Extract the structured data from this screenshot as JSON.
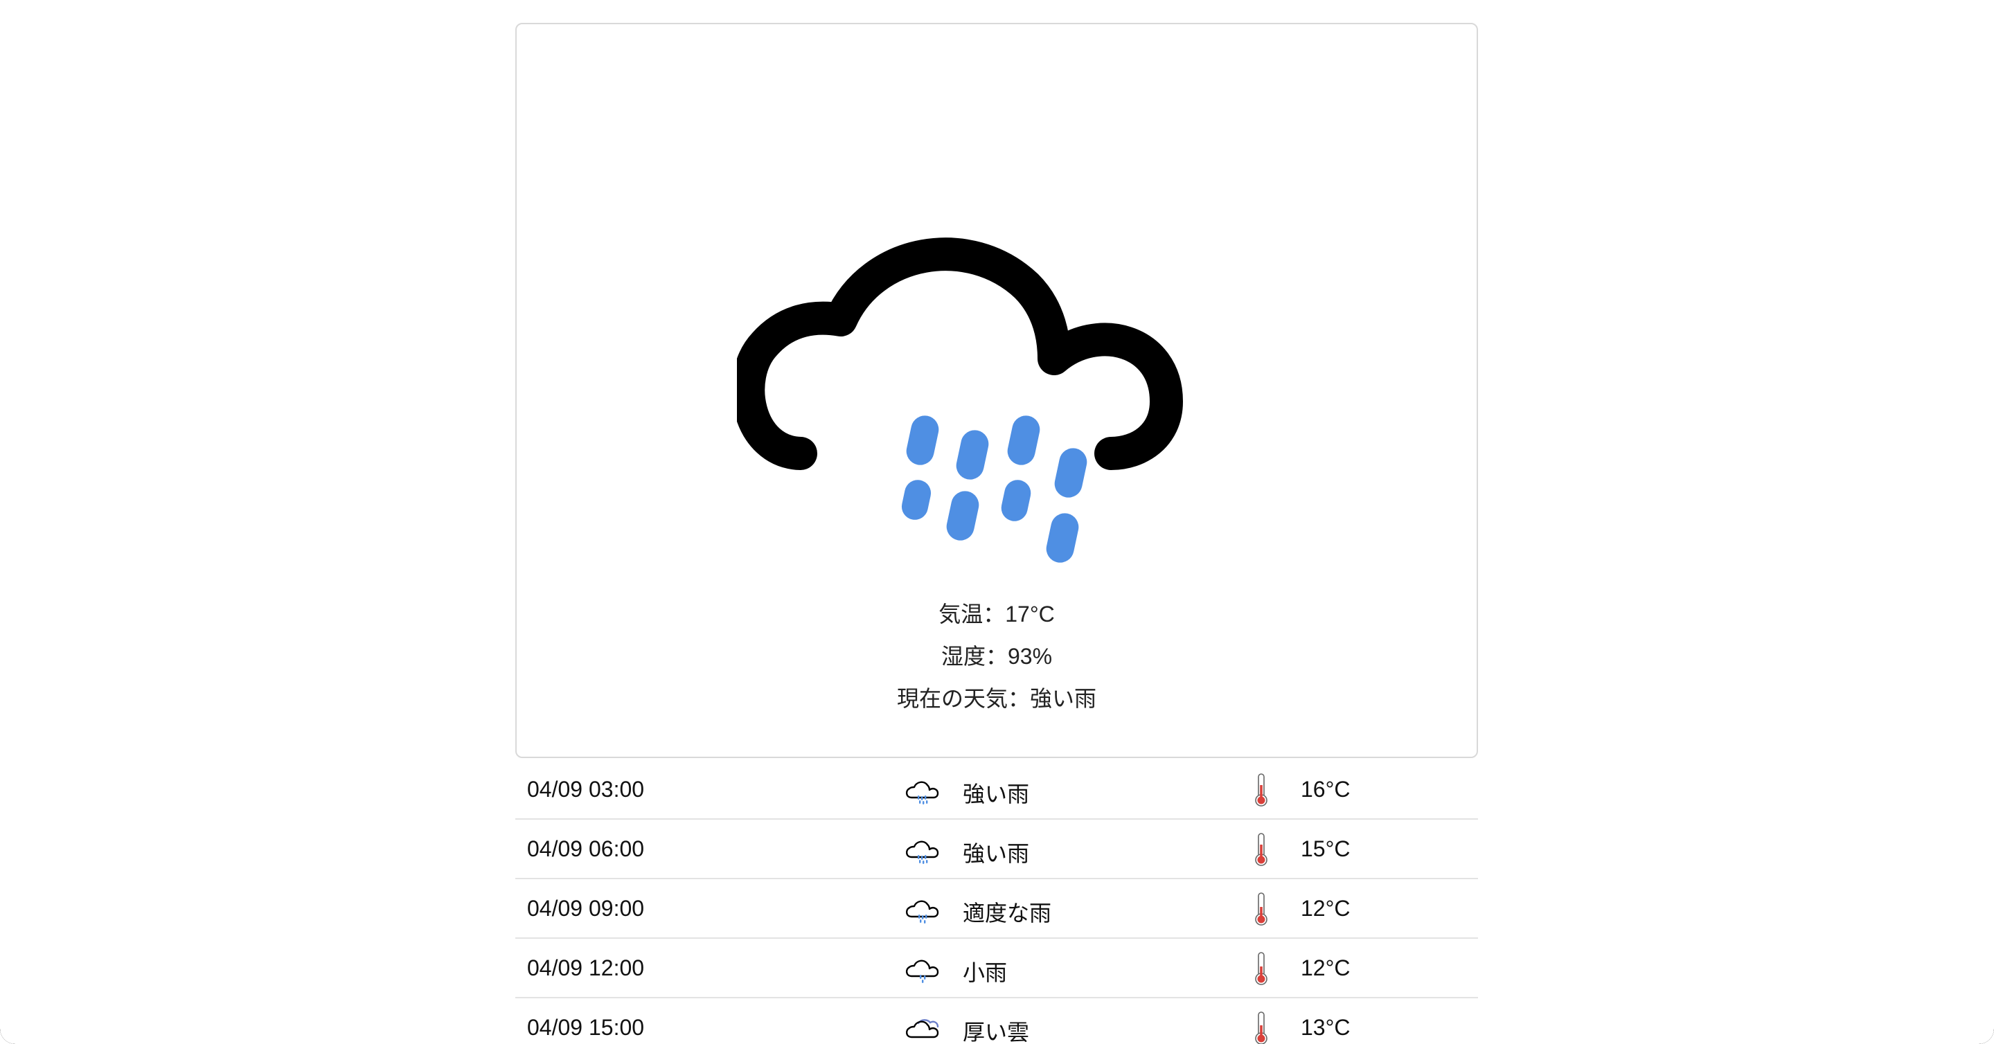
{
  "current": {
    "icon": "heavy-rain-icon",
    "temperature_label": "気温：17°C",
    "humidity_label": "湿度：93%",
    "condition_label": "現在の天気：強い雨"
  },
  "colors": {
    "rain": "#4F8FE3",
    "cloud": "#000000",
    "border": "#d9d9d9",
    "thermometer_red": "#D9403A"
  },
  "forecast": [
    {
      "time": "04/09 03:00",
      "icon": "heavy-rain-icon",
      "description": "強い雨",
      "temperature": "16°C"
    },
    {
      "time": "04/09 06:00",
      "icon": "heavy-rain-icon",
      "description": "強い雨",
      "temperature": "15°C"
    },
    {
      "time": "04/09 09:00",
      "icon": "moderate-rain-icon",
      "description": "適度な雨",
      "temperature": "12°C"
    },
    {
      "time": "04/09 12:00",
      "icon": "light-rain-icon",
      "description": "小雨",
      "temperature": "12°C"
    },
    {
      "time": "04/09 15:00",
      "icon": "overcast-cloud-icon",
      "description": "厚い雲",
      "temperature": "13°C"
    }
  ]
}
